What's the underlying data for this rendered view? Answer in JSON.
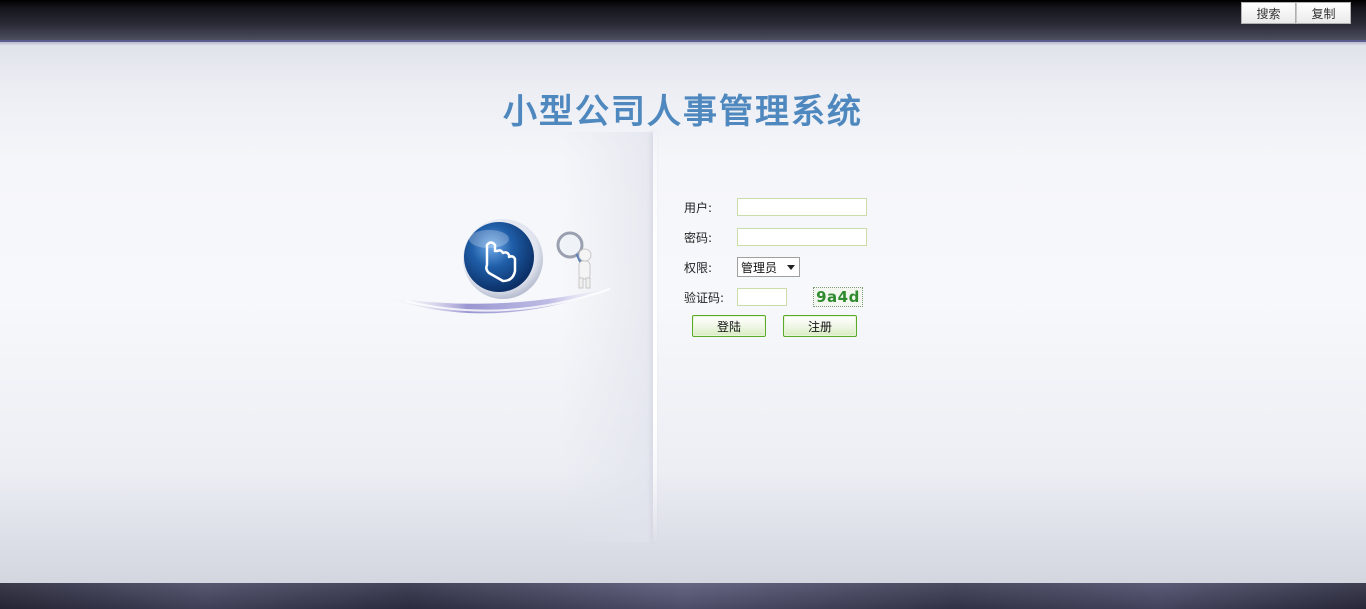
{
  "header": {
    "buttons": [
      {
        "label": "搜索"
      },
      {
        "label": "复制"
      }
    ]
  },
  "title": "小型公司人事管理系统",
  "form": {
    "user_label": "用户:",
    "user_value": "",
    "password_label": "密码:",
    "password_value": "",
    "role_label": "权限:",
    "role_selected": "管理员",
    "captcha_label": "验证码:",
    "captcha_value": "",
    "captcha_code": "9a4d",
    "login_button": "登陆",
    "register_button": "注册"
  },
  "icons": {
    "illustration": "pointing-hand-globe-icon",
    "figure": "magnifier-figure-icon",
    "dropdown": "chevron-down-icon"
  },
  "colors": {
    "title": "#4f88be",
    "captcha_text": "#2e8b2e",
    "button_border": "#5aaa2a"
  }
}
